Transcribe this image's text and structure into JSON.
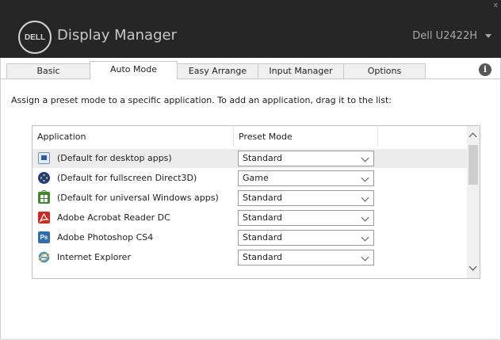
{
  "window": {
    "logo_text": "DELL",
    "title": "Display Manager",
    "monitor": "Dell U2422H",
    "close_glyph": "x"
  },
  "tabs": [
    {
      "label": "Basic"
    },
    {
      "label": "Auto Mode",
      "active": true
    },
    {
      "label": "Easy Arrange"
    },
    {
      "label": "Input Manager"
    },
    {
      "label": "Options"
    }
  ],
  "info_glyph": "i",
  "instructions": "Assign a preset mode to a specific application.  To add an application, drag it to the list:",
  "columns": {
    "application": "Application",
    "preset_mode": "Preset Mode"
  },
  "rows": [
    {
      "icon": "desktop-app-icon",
      "label": "(Default for desktop apps)",
      "mode": "Standard"
    },
    {
      "icon": "directx-icon",
      "label": "(Default for fullscreen Direct3D)",
      "mode": "Game"
    },
    {
      "icon": "windows-store-icon",
      "label": "(Default for universal Windows apps)",
      "mode": "Standard"
    },
    {
      "icon": "acrobat-icon",
      "label": "Adobe Acrobat Reader DC",
      "mode": "Standard"
    },
    {
      "icon": "photoshop-icon",
      "label": "Adobe Photoshop CS4",
      "mode": "Standard",
      "icon_text": "Ps"
    },
    {
      "icon": "internet-explorer-icon",
      "label": "Internet Explorer",
      "mode": "Standard"
    }
  ],
  "colors": {
    "titlebar": "#262626",
    "acrobat": "#d9251c",
    "photoshop": "#2d6fb5",
    "store": "#3d8a2b",
    "ie": "#2f8fd8"
  }
}
